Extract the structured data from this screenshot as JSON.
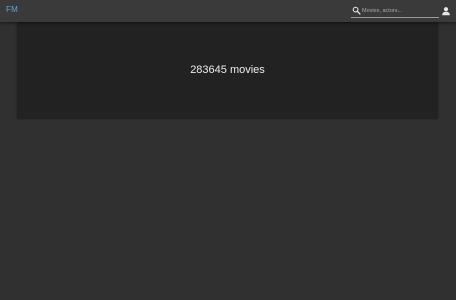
{
  "header": {
    "logo": "FM",
    "search": {
      "placeholder": "Movies, actors...",
      "value": "",
      "icon": "search-icon"
    },
    "account_icon": "account-icon"
  },
  "banner": {
    "text": "283645 movies"
  },
  "colors": {
    "page_bg": "#303030",
    "topbar_bg": "#3a3a3a",
    "banner_bg": "#222222",
    "logo": "#5aa7e0"
  }
}
